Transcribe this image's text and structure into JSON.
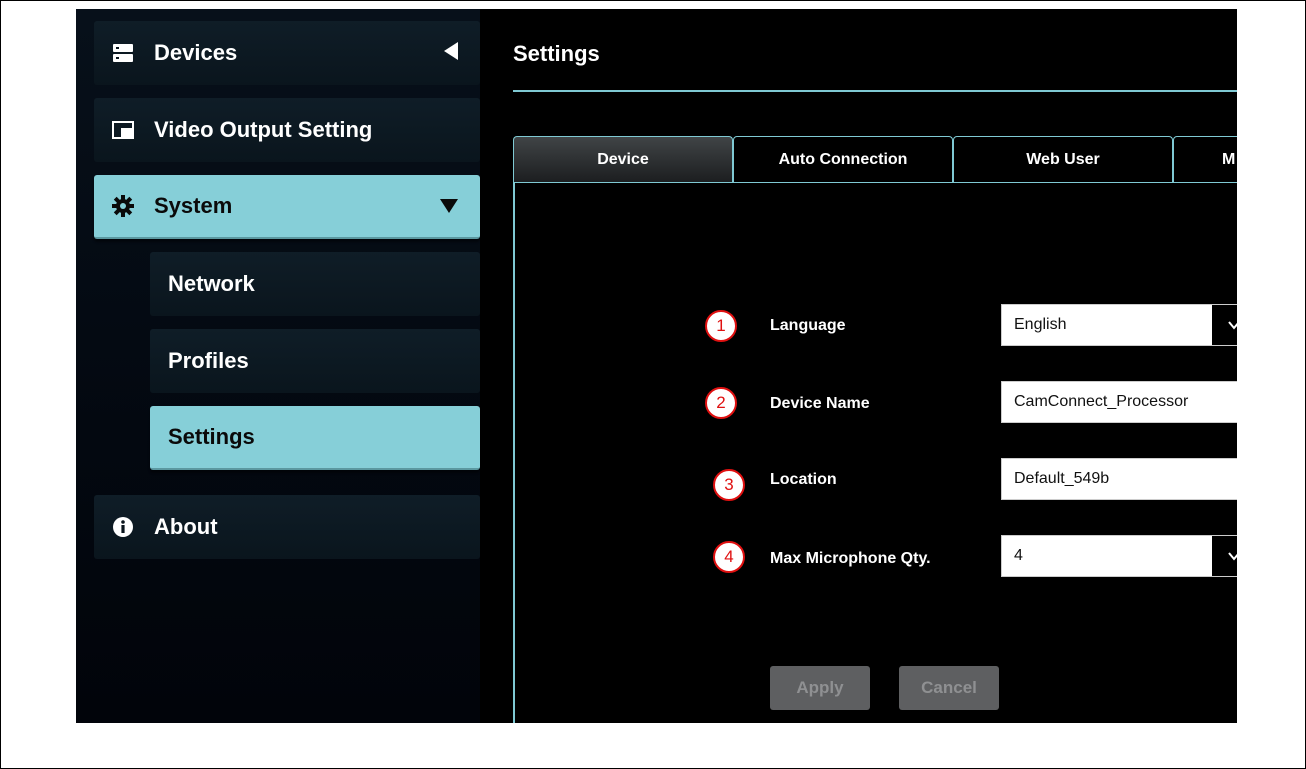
{
  "sidebar": {
    "items": [
      {
        "label": "Devices",
        "icon": "server-icon"
      },
      {
        "label": "Video Output Setting",
        "icon": "picture-in-picture-icon"
      },
      {
        "label": "System",
        "icon": "gear-icon"
      },
      {
        "label": "Network"
      },
      {
        "label": "Profiles"
      },
      {
        "label": "Settings"
      },
      {
        "label": "About",
        "icon": "info-icon"
      }
    ]
  },
  "main": {
    "title": "Settings",
    "tabs": [
      "Device",
      "Auto Connection",
      "Web User",
      "M"
    ],
    "form": {
      "rows": [
        {
          "num": "1",
          "label": "Language",
          "value": "English"
        },
        {
          "num": "2",
          "label": "Device Name",
          "value": "CamConnect_Processor"
        },
        {
          "num": "3",
          "label": "Location",
          "value": "Default_549b"
        },
        {
          "num": "4",
          "label": "Max Microphone Qty.",
          "value": "4"
        }
      ],
      "apply_label": "Apply",
      "cancel_label": "Cancel"
    }
  },
  "colors": {
    "accent": "#86cfd8",
    "annotation": "#e01010",
    "disabled_button": "#5e5f61"
  }
}
